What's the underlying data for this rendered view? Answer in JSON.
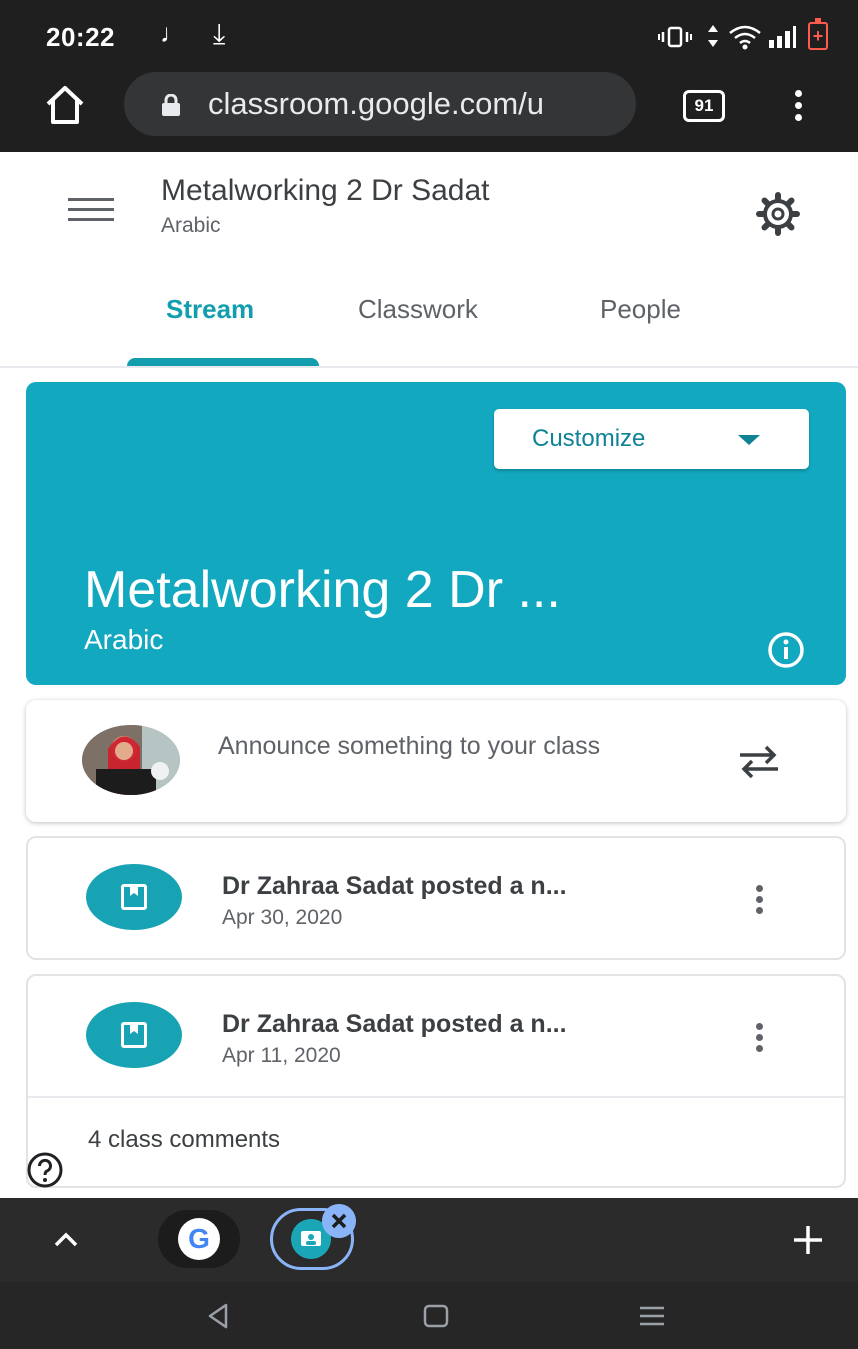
{
  "status_bar": {
    "time": "20:22",
    "music_glyph": "♩",
    "download_glyph": "⤓"
  },
  "browser": {
    "url": "classroom.google.com/u",
    "tab_count": "91"
  },
  "header": {
    "title": "Metalworking 2 Dr Sadat",
    "subtitle": "Arabic"
  },
  "tabs": [
    {
      "label": "Stream",
      "active": true
    },
    {
      "label": "Classwork",
      "active": false
    },
    {
      "label": "People",
      "active": false
    }
  ],
  "banner": {
    "customize_label": "Customize",
    "title": "Metalworking 2 Dr ...",
    "subtitle": "Arabic"
  },
  "announce": {
    "placeholder": "Announce something to your class"
  },
  "posts": [
    {
      "title": "Dr Zahraa Sadat posted a n...",
      "date": "Apr 30, 2020"
    },
    {
      "title": "Dr Zahraa Sadat posted a n...",
      "date": "Apr 11, 2020",
      "comments": "4 class comments"
    }
  ],
  "bottom_bar": {
    "google_letter": "G",
    "plus": "+"
  },
  "colors": {
    "accent": "#129eaf",
    "banner": "#12a8bf",
    "chrome_dark": "#1f1f1f"
  }
}
